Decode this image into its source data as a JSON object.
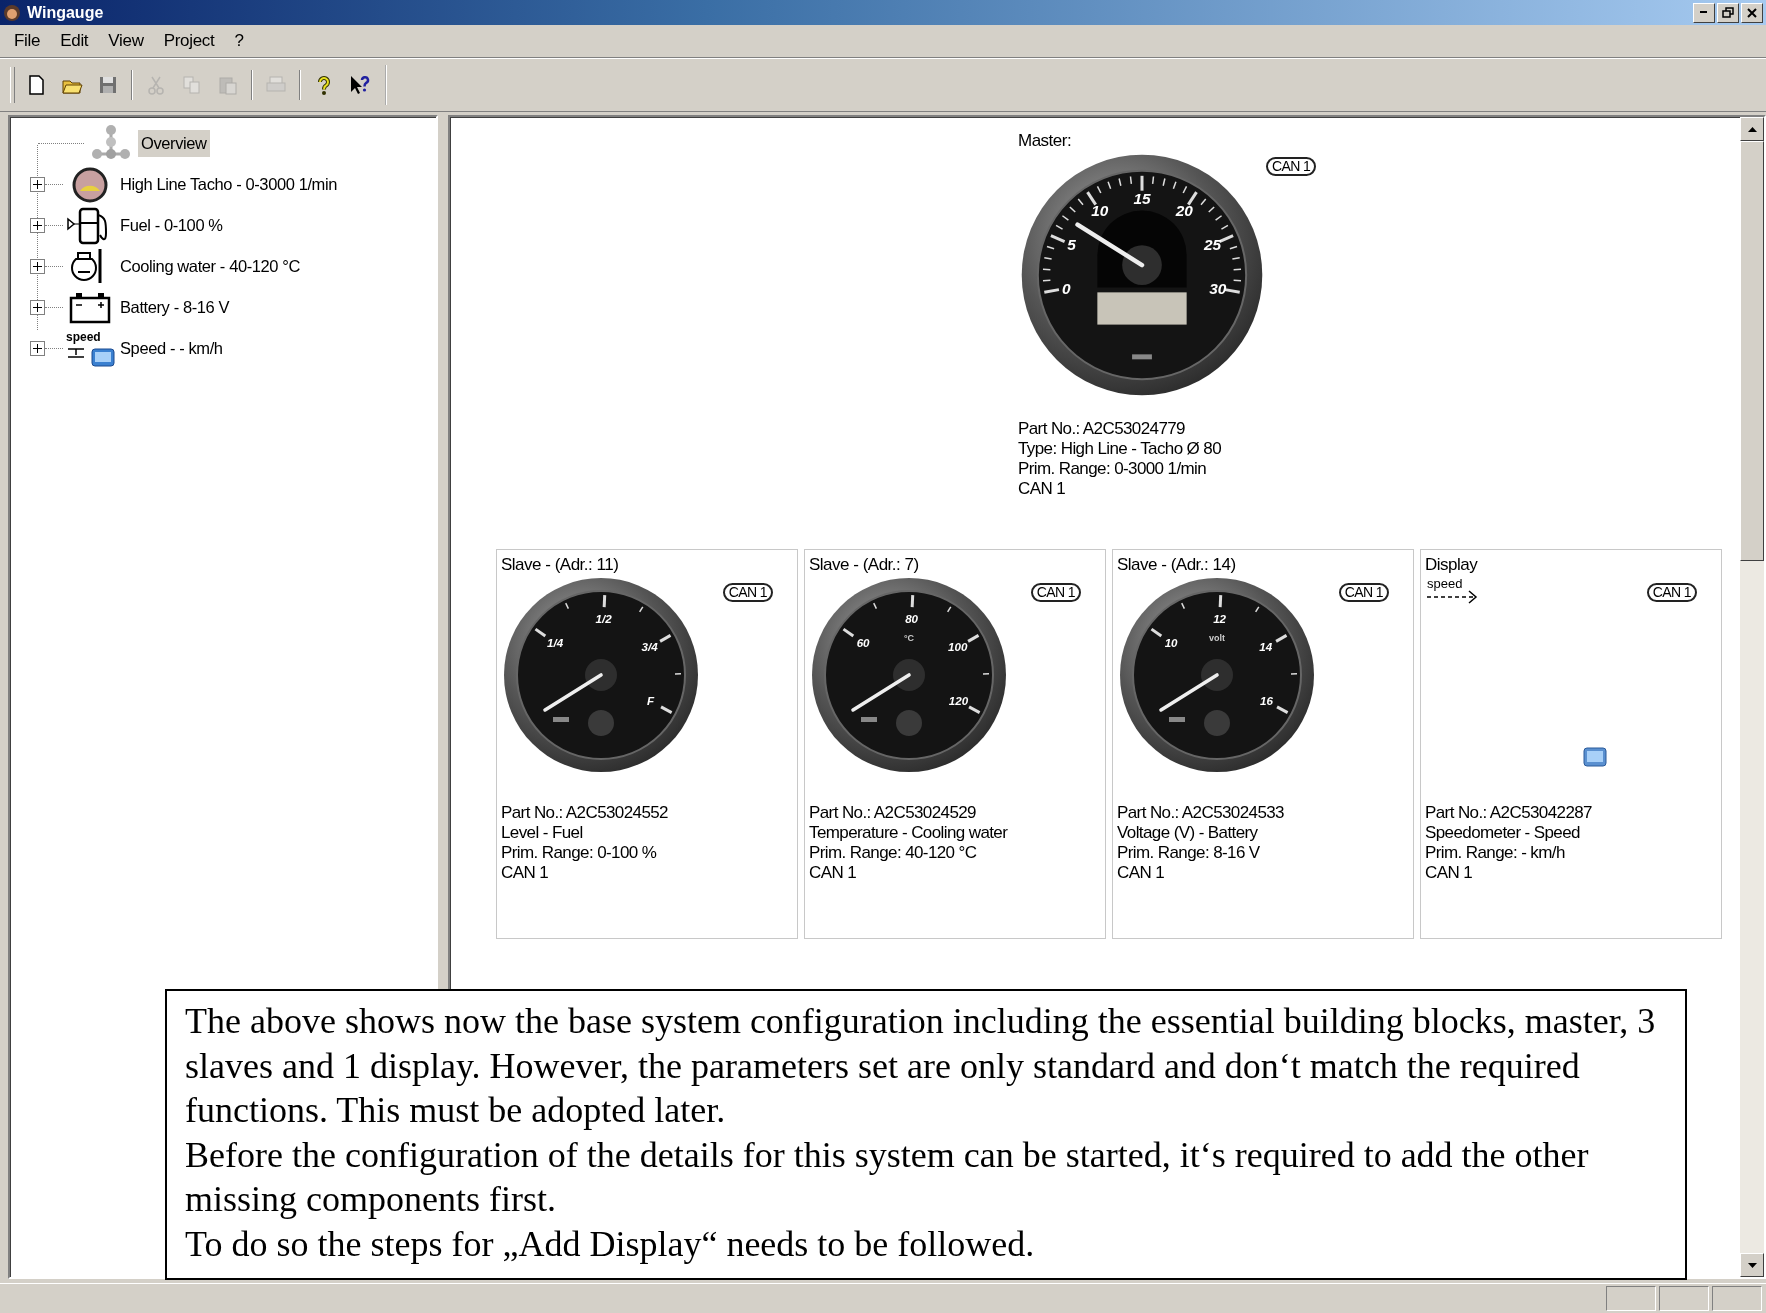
{
  "window": {
    "title": "Wingauge"
  },
  "menu": [
    "File",
    "Edit",
    "View",
    "Project",
    "?"
  ],
  "toolbar": [
    {
      "kind": "button",
      "disabled": false
    },
    {
      "kind": "button",
      "disabled": false
    },
    {
      "kind": "button",
      "disabled": false
    },
    {
      "kind": "separator"
    },
    {
      "kind": "button",
      "disabled": true
    },
    {
      "kind": "button",
      "disabled": true
    },
    {
      "kind": "button",
      "disabled": true
    },
    {
      "kind": "separator"
    },
    {
      "kind": "button",
      "disabled": true
    },
    {
      "kind": "separator"
    },
    {
      "kind": "button",
      "disabled": false
    },
    {
      "kind": "button",
      "disabled": false
    }
  ],
  "tree": {
    "root": {
      "label": "Overview",
      "selected": true
    },
    "items": [
      {
        "label": "High Line Tacho - 0-3000 1/min",
        "expanded": false,
        "selected": false
      },
      {
        "label": "Fuel - 0-100 %",
        "expanded": false,
        "selected": false
      },
      {
        "label": "Cooling water - 40-120 °C",
        "expanded": false,
        "selected": false
      },
      {
        "label": "Battery - 8-16 V",
        "expanded": false,
        "selected": false
      },
      {
        "label": "Speed - - km/h",
        "icon_text": "speed",
        "expanded": false,
        "selected": false
      }
    ]
  },
  "master": {
    "title": "Master:",
    "bus": "CAN 1",
    "gauge": {
      "kind": "tacho",
      "dial_labels": [
        "0",
        "5",
        "10",
        "15",
        "20",
        "25",
        "30"
      ]
    },
    "info": [
      "Part No.: A2C53024779",
      "Type: High Line - Tacho Ø 80",
      "Prim. Range: 0-3000 1/min",
      "CAN 1"
    ]
  },
  "devices": [
    {
      "title": "Slave - (Adr.: 11)",
      "bus": "CAN 1",
      "gauge": {
        "kind": "fuel",
        "dial_labels": [
          "1/4",
          "1/2",
          "3/4",
          "F"
        ]
      },
      "info": [
        "Part No.: A2C53024552",
        "Level - Fuel",
        "Prim. Range: 0-100 %",
        "CAN 1"
      ]
    },
    {
      "title": "Slave - (Adr.: 7)",
      "bus": "CAN 1",
      "gauge": {
        "kind": "temperature",
        "unit": "°C",
        "dial_labels": [
          "60",
          "80",
          "100",
          "120"
        ]
      },
      "info": [
        "Part No.: A2C53024529",
        "Temperature - Cooling water",
        "Prim. Range: 40-120 °C",
        "CAN 1"
      ]
    },
    {
      "title": "Slave - (Adr.: 14)",
      "bus": "CAN 1",
      "gauge": {
        "kind": "battery",
        "unit": "volt",
        "dial_labels": [
          "10",
          "12",
          "14",
          "16"
        ]
      },
      "info": [
        "Part No.: A2C53024533",
        "Voltage (V) - Battery",
        "Prim. Range: 8-16 V",
        "CAN 1"
      ]
    },
    {
      "title": "Display",
      "bus": "CAN 1",
      "gauge": {
        "kind": "display",
        "icon_text": "speed"
      },
      "info": [
        "Part No.: A2C53042287",
        "Speedometer - Speed",
        "Prim. Range: - km/h",
        "CAN 1"
      ]
    }
  ],
  "note": {
    "paragraphs": [
      "The above shows now the base system configuration including the essential building blocks, master, 3 slaves and 1 display. However, the parameters set are only standard and don‘t match the required functions. This must be adopted later.",
      "Before the configuration of the details for this system can be started, it‘s required to add the other missing components first.",
      "To do so the steps for „Add Display“ needs to be followed."
    ]
  }
}
